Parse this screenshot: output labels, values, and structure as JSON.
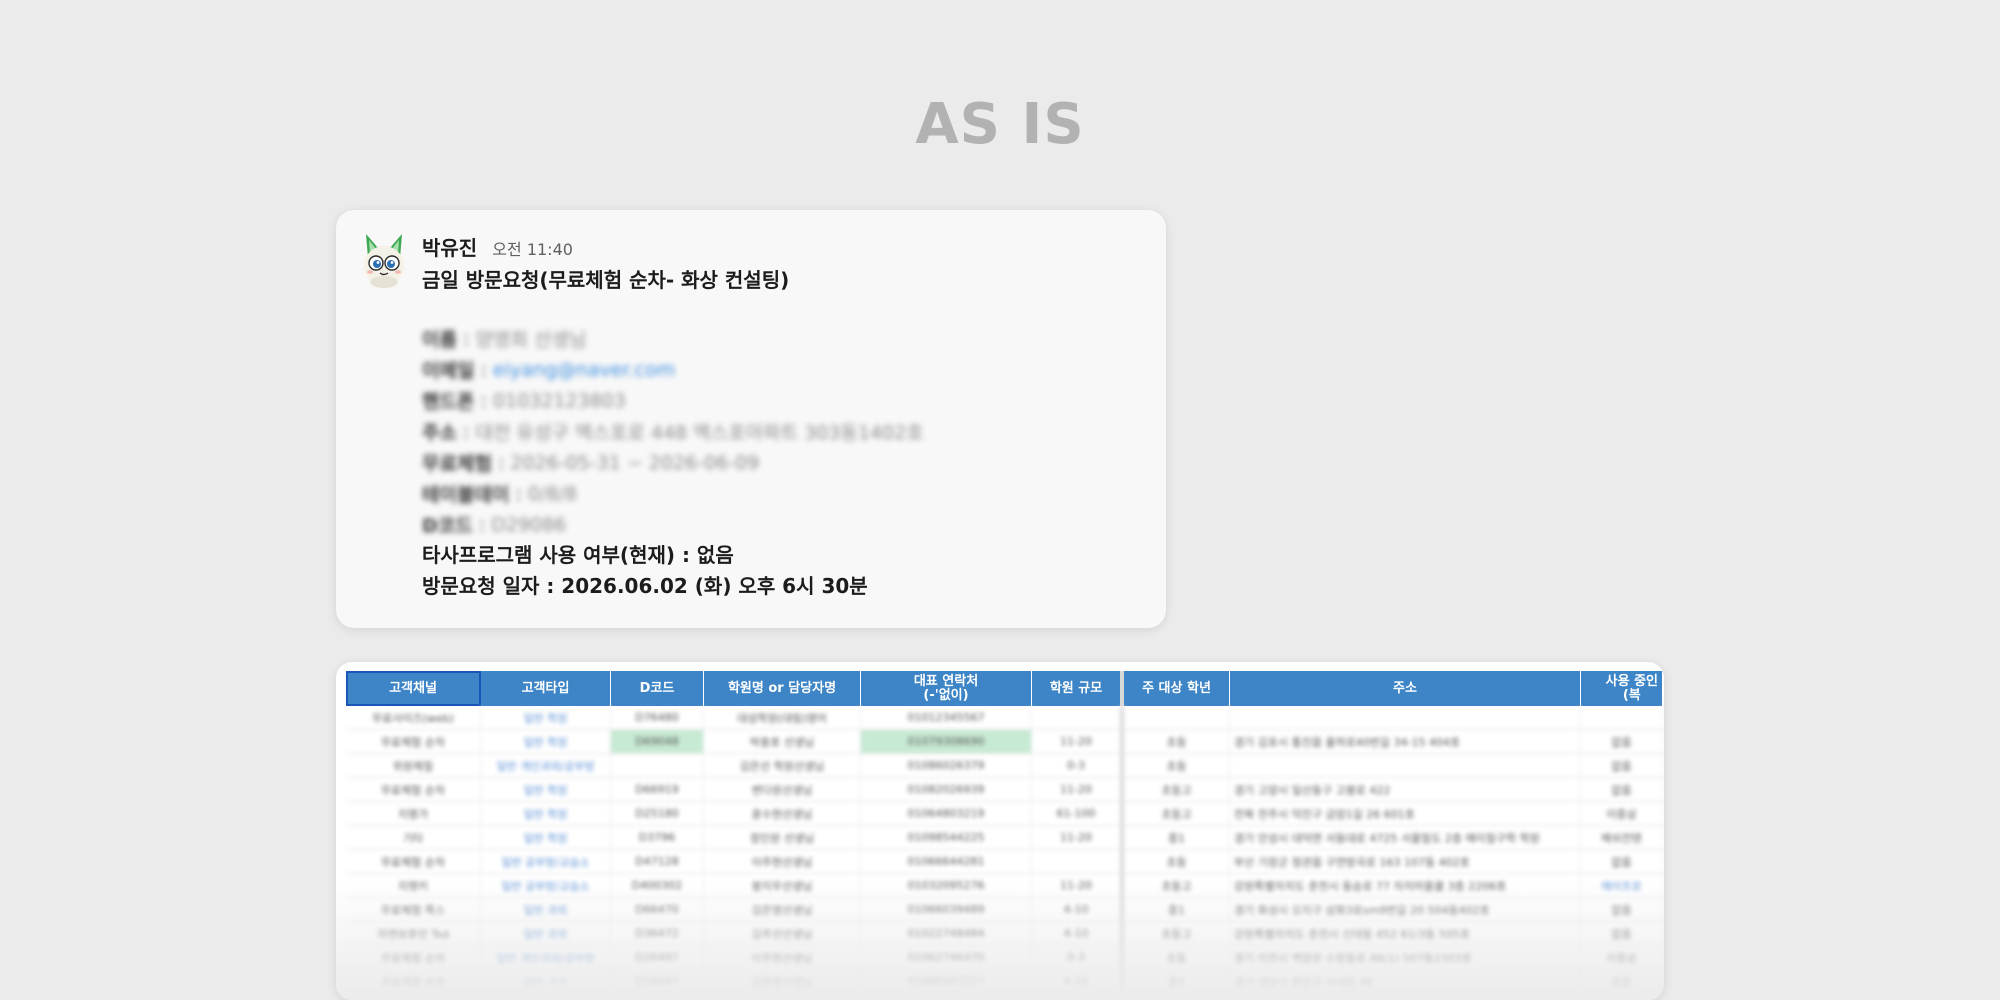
{
  "page": {
    "title": "AS IS"
  },
  "message": {
    "sender": "박유진",
    "time": "오전 11:40",
    "subject": "금일 방문요청(무료체험 순차- 화상 컨설팅)",
    "blurred_fields": [
      {
        "key": "이름",
        "value": "양영희 선생님",
        "link": false
      },
      {
        "key": "이메일",
        "value": "eiyang@naver.com",
        "link": true
      },
      {
        "key": "핸드폰",
        "value": "01032123803",
        "link": false
      },
      {
        "key": "주소",
        "value": "대전 유성구 엑스포로 448 엑스포아파트 303동1402호",
        "link": false
      },
      {
        "key": "무료체험",
        "value": "2026-05-31 ~ 2026-06-09",
        "link": false
      },
      {
        "key": "테이블데이",
        "value": "0/8/8",
        "link": false
      },
      {
        "key": "D코드",
        "value": "D29086",
        "link": false
      }
    ],
    "other_program": "타사프로그램 사용 여부(현재) : 없음",
    "visit_date": "방문요청 일자 : 2026.06.02 (화) 오후 6시 30분"
  },
  "sheet": {
    "headers": [
      "고객채널",
      "고객타입",
      "D코드",
      "학원명 or 담당자명",
      "대표 연락처\n(-'없이)",
      "학원 규모",
      "주 대상 학년",
      "주소",
      "사용 중인\n(복"
    ],
    "rows": [
      [
        "무료사이즈(web)",
        "일반 학원",
        "D76480",
        "대성학원(대림)영어",
        "01012345567",
        "",
        "",
        "",
        ""
      ],
      [
        "무료체험 순차",
        "일반 학원",
        "D69048",
        "박충호 선생님",
        "01079308690",
        "11-20",
        "초등",
        "경기 김포시 통진읍 율하로40번길 34-15 404호",
        "없음"
      ],
      [
        "위원체질",
        "일반 개인과외/공부방",
        "",
        "김은선 학원선생님",
        "01086026379",
        "0-3",
        "초등",
        "",
        "없음"
      ],
      [
        "무료체험 순차",
        "일반 학원",
        "D66919",
        "변다원선생님",
        "01082026939",
        "11-20",
        "초등고",
        "경기 고양시 일산동구 고봉로 422",
        "없음"
      ],
      [
        "지명가",
        "일반 학원",
        "D25180",
        "윤수현선생님",
        "01064803219",
        "61-100",
        "초등고",
        "전북 전주시 덕진구 금암1길 26 601호",
        "이중삼"
      ],
      [
        "기타",
        "일반 학원",
        "D3796",
        "정인원 선생님",
        "01098544225",
        "11-20",
        "중1",
        "경기 안성시 대덕면 서동대로 4725 서울밀도 2층 에이칠구학 학원",
        "메쉬컨텐"
      ],
      [
        "무료체험 순차",
        "일반 공부방/교습소",
        "D47128",
        "이주현선생님",
        "01066644281",
        "",
        "초등",
        "부산 기장군 정관읍 구연방곡로 163 107동 402호",
        "없음"
      ],
      [
        "지렛키",
        "일반 공부방/교습소",
        "D400302",
        "왕지우선생님",
        "01032095276",
        "11-20",
        "초등고",
        "강원특별자치도 춘천시 동승로 77 자치마을쿨 3층 2206호",
        "에이프로"
      ],
      [
        "무료체험 쪽스",
        "일반 과외",
        "D66470",
        "김은영선생님",
        "01066039489",
        "4-10",
        "중1",
        "경기 화성시 오지구 삼화3로sm9번길 20 504동402호",
        "없음"
      ],
      [
        "자연보호인 Tsd",
        "일반 과외",
        "D36472",
        "김주선선생님",
        "01022748484",
        "4-10",
        "초등고",
        "강원특별자치도 춘천시 신대동 452 61/3동 505호",
        "없음"
      ],
      [
        "무료체험 순차",
        "일반 개인과외/공부방",
        "D26497",
        "이주현선생님",
        "01062746470",
        "0-3",
        "초등",
        "경기 이천시 백양로 수원동로 46(1) 507동2303호",
        "이중삼"
      ],
      [
        "무료체험 순차",
        "일반 과외",
        "D18247",
        "김은영선생님",
        "01060347227",
        "4-10",
        "중1",
        "경기 성남시 분당구 수내로 46",
        "없음"
      ]
    ]
  },
  "colors": {
    "background": "#ebebeb",
    "title": "#b2b2b2",
    "header_blue": "#3d85c6",
    "link_blue": "#3b8de0",
    "green_highlight": "#c7ead3"
  },
  "icons": {
    "avatar": "green-eared-mascot-icon"
  }
}
